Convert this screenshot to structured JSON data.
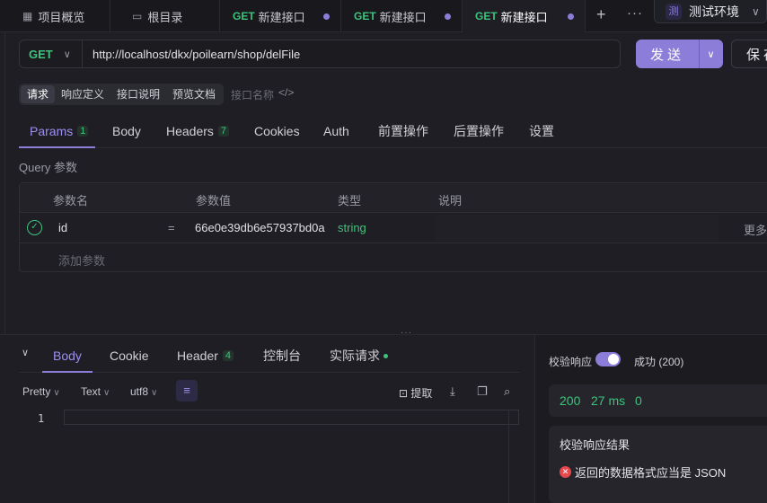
{
  "tabs": [
    {
      "icon": "grid-icon",
      "label": "项目概览"
    },
    {
      "icon": "folder-icon",
      "label": "根目录"
    },
    {
      "method": "GET",
      "label": "新建接口",
      "dirty": true
    },
    {
      "method": "GET",
      "label": "新建接口",
      "dirty": true
    },
    {
      "method": "GET",
      "label": "新建接口",
      "dirty": true,
      "active": true
    }
  ],
  "environment": {
    "badge": "测",
    "label": "测试环境"
  },
  "request": {
    "method": "GET",
    "url": "http://localhost/dkx/poilearn/shop/delFile",
    "send_label": "发送",
    "save_label": "保存"
  },
  "sub_tabs": [
    "请求",
    "响应定义",
    "接口说明",
    "预览文档"
  ],
  "interface_name_placeholder": "接口名称",
  "param_tabs": [
    {
      "label": "Params",
      "count": "1"
    },
    {
      "label": "Body"
    },
    {
      "label": "Headers",
      "count": "7"
    },
    {
      "label": "Cookies"
    },
    {
      "label": "Auth"
    },
    {
      "label": "前置操作"
    },
    {
      "label": "后置操作"
    },
    {
      "label": "设置"
    }
  ],
  "query_label": "Query 参数",
  "params_table": {
    "headers": [
      "参数名",
      "参数值",
      "类型",
      "说明"
    ],
    "rows": [
      {
        "name": "id",
        "eq": "=",
        "value": "66e0e39db6e57937bd0a",
        "type": "string",
        "more": "更多"
      }
    ],
    "add_label": "添加参数"
  },
  "response": {
    "tabs": [
      {
        "label": "Body"
      },
      {
        "label": "Cookie"
      },
      {
        "label": "Header",
        "count": "4"
      },
      {
        "label": "控制台"
      },
      {
        "label": "实际请求",
        "dot": true
      }
    ],
    "format": [
      "Pretty",
      "Text",
      "utf8"
    ],
    "extract_label": "提取",
    "line_number": "1",
    "validate_label": "校验响应",
    "validate_on": true,
    "status_text": "成功 (200)",
    "stats": {
      "code": "200",
      "time": "27 ms",
      "size": "0"
    },
    "result_title": "校验响应结果",
    "result_error": "返回的数据格式应当是 JSON"
  },
  "colors": {
    "accent": "#8b7dd8",
    "get_method": "#3cc47c",
    "error": "#e5484d"
  }
}
